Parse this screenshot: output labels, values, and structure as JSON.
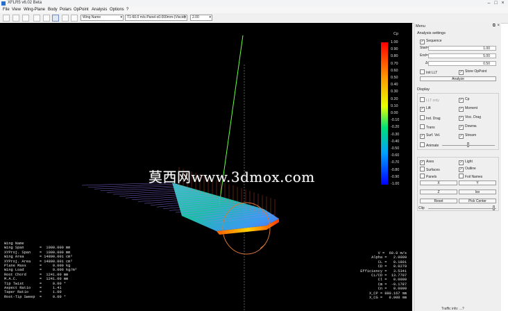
{
  "window": {
    "title": "XFLR5 v6.02 Beta"
  },
  "menu": [
    "File",
    "View",
    "Wing-Plane",
    "Body",
    "Polars",
    "OpPoint",
    "Analysis",
    "Options",
    "?"
  ],
  "toolbar": {
    "plane_combo": "Wing Name",
    "polar_combo": "T1-60.0 m/s-Panel-x0.000mm-(Viscid)",
    "oppoint_combo": "2.00"
  },
  "legend": {
    "title": "Cp",
    "ticks": [
      "1.00",
      "0.90",
      "0.80",
      "0.70",
      "0.60",
      "0.50",
      "0.40",
      "0.30",
      "0.20",
      "0.10",
      "0.00",
      "-0.10",
      "-0.20",
      "-0.30",
      "-0.40",
      "-0.50",
      "-0.60",
      "-0.70",
      "-0.80",
      "-0.90",
      "-1.00"
    ],
    "colors": [
      "#ff0000",
      "#ff7a00",
      "#ffe000",
      "#00e07a",
      "#00a0ff",
      "#0000ff"
    ]
  },
  "left_stats": [
    "Wing Name",
    "Wing Span       =  1000.000 mm",
    "XYProj. Span    =  1000.000 mm",
    "Wing Area       = 14800.001 cm²",
    "XYProj. Area    = 14800.001 cm²",
    "Plane Mass      =     0.000 kg",
    "Wing Load       =     0.000 kg/m²",
    "Root Chord      =  1241.00 mm",
    "M.A.C.          =  1241.00 mm",
    "Tip Twist       =     0.00 °",
    "Aspect Ratio    =     1.41",
    "Taper Ratio     =     1.00",
    "Root-Tip Sweep  =     0.00 °"
  ],
  "right_stats": [
    "V =  60.0 m/s",
    "Alpha =   2.0000",
    "CL =   0.1801",
    "CD =   0.0279",
    "Efficiency =   3.5341",
    "CL/CD =  13.7707",
    "Cl =   0.0000",
    "Cm =  -0.1787",
    "Cn =   0.0000",
    "X_CP = 880.167 mm",
    "X_CG =   0.000 mm"
  ],
  "watermark": "莫西网www.3dmox.com",
  "panel": {
    "title": "Menu",
    "analysis_settings": "Analysis settings",
    "sequence": "Sequence",
    "start_label": "Start=",
    "start_value": "1.00",
    "end_label": "End=",
    "end_value": "5.00",
    "delta_label": "Δ=",
    "delta_value": "0.50",
    "init_llt": "Init LLT",
    "store_oppoint": "Store OpPoint",
    "analyze": "Analyze",
    "display": "Display",
    "llt_only": "LLT only",
    "cp": "Cp",
    "lift": "Lift",
    "moment": "Moment",
    "ind_drag": "Ind. Drag",
    "visc_drag": "Visc. Drag",
    "trans": "Trans",
    "downw": "Downw.",
    "surf_vel": "Surf. Vel.",
    "stream": "Stream",
    "animate": "Animate",
    "axes": "Axes",
    "light": "Light",
    "surfaces": "Surfaces",
    "outline": "Outline",
    "panels": "Panels",
    "foil_names": "Foil Names",
    "view_x": "X",
    "view_y": "Y",
    "view_z": "Z",
    "view_iso": "Iso",
    "reset": "Reset",
    "pick_center": "Pick Center",
    "clip": "Clip"
  },
  "footer": "Traffic info: ...?"
}
